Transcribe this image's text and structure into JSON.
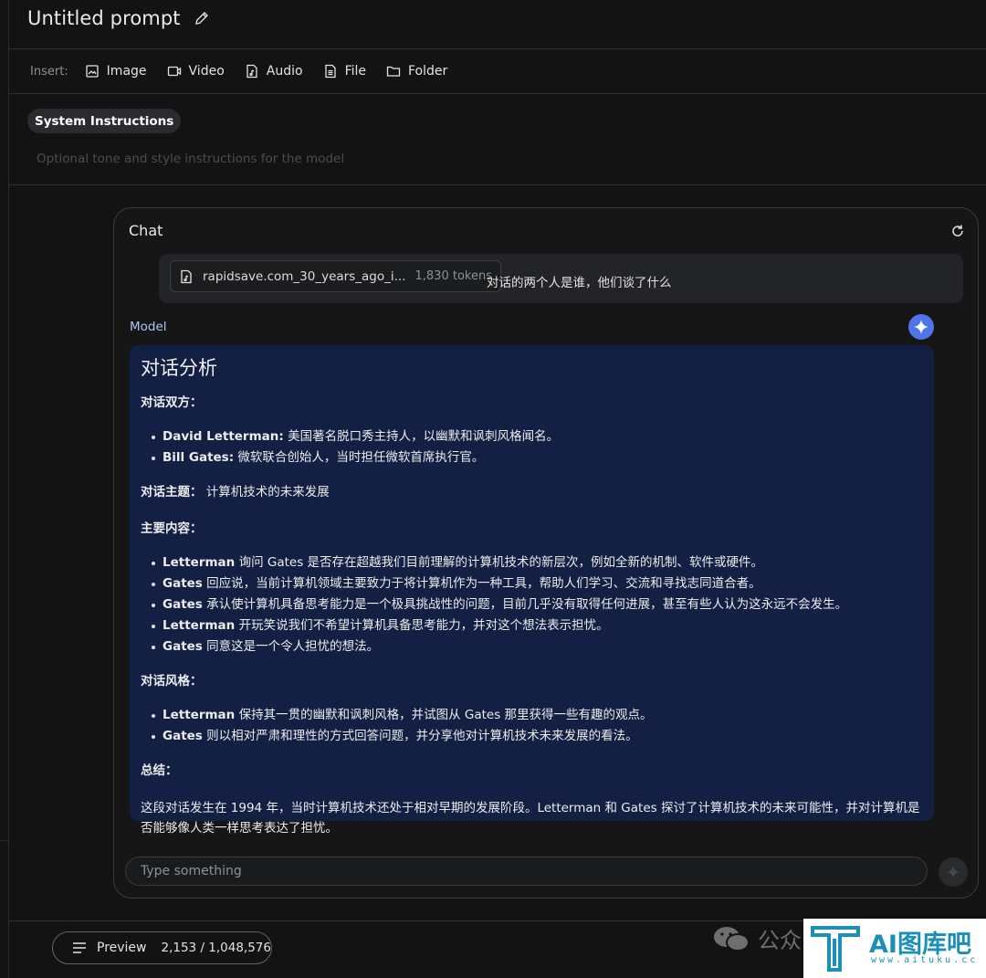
{
  "header": {
    "title": "Untitled prompt"
  },
  "insert_bar": {
    "label": "Insert:",
    "items": [
      {
        "label": "Image",
        "icon": "image-icon"
      },
      {
        "label": "Video",
        "icon": "video-icon"
      },
      {
        "label": "Audio",
        "icon": "audio-icon"
      },
      {
        "label": "File",
        "icon": "file-icon"
      },
      {
        "label": "Folder",
        "icon": "folder-icon"
      }
    ]
  },
  "system_instructions": {
    "label": "System Instructions",
    "placeholder": "Optional tone and style instructions for the model"
  },
  "chat": {
    "title": "Chat",
    "user_message": {
      "file_name": "rapidsave.com_30_years_ago_i...",
      "file_tokens": "1,830 tokens",
      "text": "对话的两个人是谁，他们谈了什么"
    },
    "model_label": "Model",
    "response": {
      "heading": "对话分析",
      "participants_title": "对话双方：",
      "participants": [
        {
          "name": "David Letterman:",
          "text": " 美国著名脱口秀主持人，以幽默和讽刺风格闻名。"
        },
        {
          "name": "Bill Gates:",
          "text": " 微软联合创始人，当时担任微软首席执行官。"
        }
      ],
      "topic_title": "对话主题：",
      "topic_text": " 计算机技术的未来发展",
      "content_title": "主要内容：",
      "content": [
        {
          "name": "Letterman",
          "text": " 询问 Gates 是否存在超越我们目前理解的计算机技术的新层次，例如全新的机制、软件或硬件。"
        },
        {
          "name": "Gates",
          "text": " 回应说，当前计算机领域主要致力于将计算机作为一种工具，帮助人们学习、交流和寻找志同道合者。"
        },
        {
          "name": "Gates",
          "text": " 承认使计算机具备思考能力是一个极具挑战性的问题，目前几乎没有取得任何进展，甚至有些人认为这永远不会发生。"
        },
        {
          "name": "Letterman",
          "text": " 开玩笑说我们不希望计算机具备思考能力，并对这个想法表示担忧。"
        },
        {
          "name": "Gates",
          "text": " 同意这是一个令人担忧的想法。"
        }
      ],
      "style_title": "对话风格：",
      "style": [
        {
          "name": "Letterman",
          "text": " 保持其一贯的幽默和讽刺风格，并试图从 Gates 那里获得一些有趣的观点。"
        },
        {
          "name": "Gates",
          "text": " 则以相对严肃和理性的方式回答问题，并分享他对计算机技术未来发展的看法。"
        }
      ],
      "summary_title": "总结：",
      "summary_text": "这段对话发生在 1994 年，当时计算机技术还处于相对早期的发展阶段。Letterman 和 Gates 探讨了计算机技术的未来可能性，并对计算机是否能够像人类一样思考表达了担忧。"
    },
    "input_placeholder": "Type something"
  },
  "footer": {
    "preview_label": "Preview",
    "token_count": "2,153 / 1,048,576"
  },
  "watermark": {
    "wechat_text": "公众",
    "logo_text": "AI图库吧",
    "logo_sub": "www.aituku.cc"
  },
  "colors": {
    "background": "#131314",
    "model_card": "#132044",
    "accent": "#a8c7fa",
    "avatar": "#4f75e8"
  }
}
